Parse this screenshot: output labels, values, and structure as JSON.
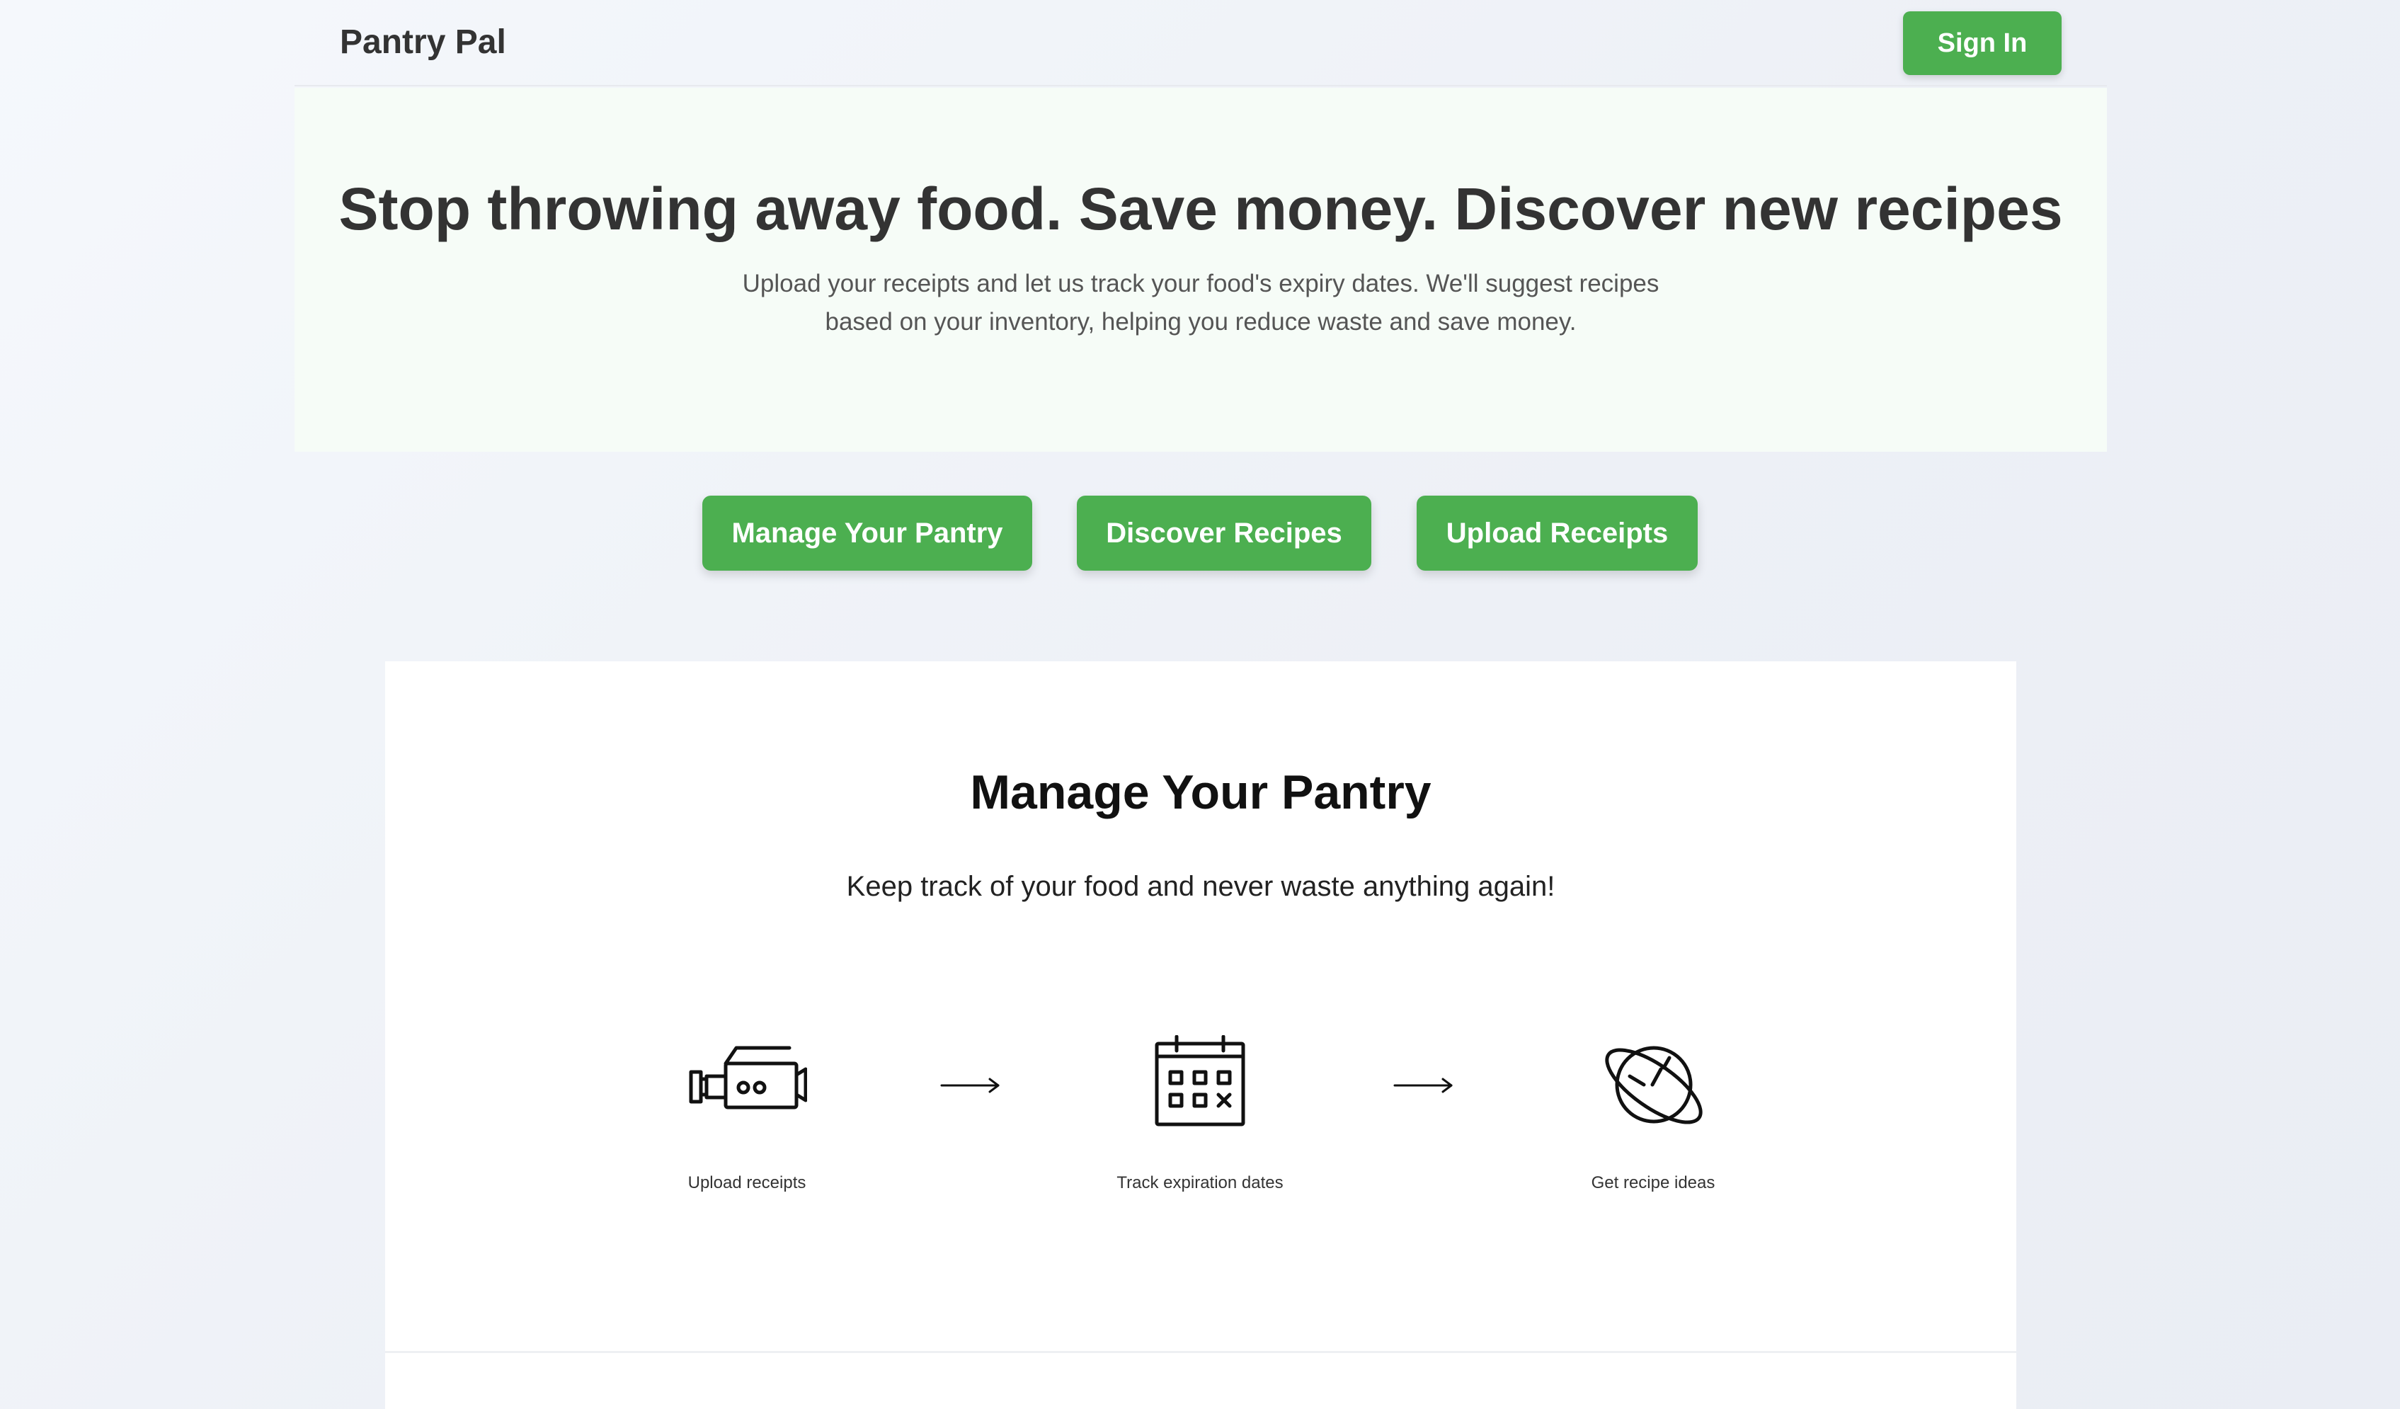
{
  "header": {
    "logo": "Pantry Pal",
    "sign_in": "Sign In"
  },
  "hero": {
    "title": "Stop throwing away food. Save money. Discover new recipes",
    "subtitle_line1": "Upload your receipts and let us track your food's expiry dates. We'll suggest recipes",
    "subtitle_line2": "based on your inventory, helping you reduce waste and save money."
  },
  "actions": [
    {
      "label": "Manage Your Pantry"
    },
    {
      "label": "Discover Recipes"
    },
    {
      "label": "Upload Receipts"
    }
  ],
  "section": {
    "title": "Manage Your Pantry",
    "subtitle": "Keep track of your food and never waste anything again!",
    "steps": [
      {
        "icon": "video-camera-icon",
        "label": "Upload receipts"
      },
      {
        "icon": "calendar-icon",
        "label": "Track expiration dates"
      },
      {
        "icon": "planet-icon",
        "label": "Get recipe ideas"
      }
    ]
  },
  "colors": {
    "accent": "#4caf50",
    "hero_background": "#f6fcf7",
    "text": "#333333"
  }
}
